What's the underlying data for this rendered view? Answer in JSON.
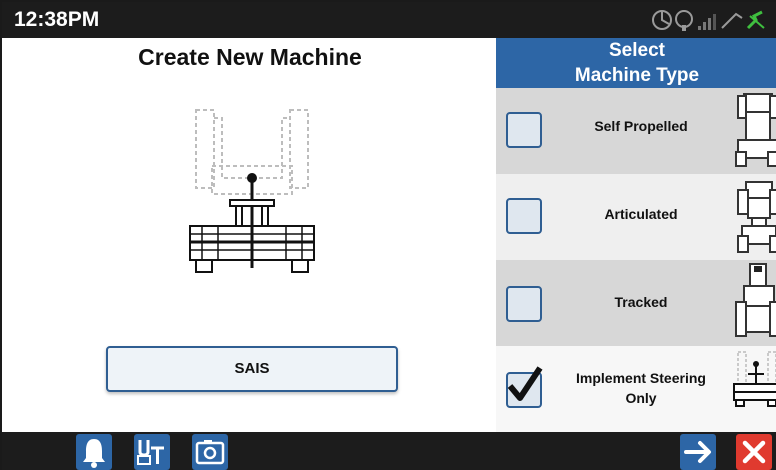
{
  "status_bar": {
    "time": "12:38PM",
    "icons": [
      "gps-icon",
      "info-icon",
      "signal-bars-icon",
      "antenna-icon",
      "connection-icon"
    ]
  },
  "left_panel": {
    "title": "Create New Machine",
    "illustration": "implement-steering-machine-icon",
    "selected_button_label": "SAIS"
  },
  "right_panel": {
    "header_line1": "Select",
    "header_line2": "Machine Type",
    "machine_types": [
      {
        "label": "Self Propelled",
        "checked": false,
        "thumb": "self-propelled-machine-icon"
      },
      {
        "label": "Articulated",
        "checked": false,
        "thumb": "articulated-machine-icon"
      },
      {
        "label": "Tracked",
        "checked": false,
        "thumb": "tracked-machine-icon"
      },
      {
        "label_line1": "Implement Steering",
        "label_line2": "Only",
        "checked": true,
        "thumb": "implement-machine-icon"
      }
    ]
  },
  "bottom_bar": {
    "left_buttons": [
      "bell-icon",
      "universal-terminal-icon",
      "camera-icon"
    ],
    "right_buttons": [
      "arrow-right-icon",
      "close-icon"
    ]
  },
  "colors": {
    "accent_blue": "#2d66a6",
    "cancel_red": "#e03a2f",
    "status_bar": "#1c1c1c"
  }
}
